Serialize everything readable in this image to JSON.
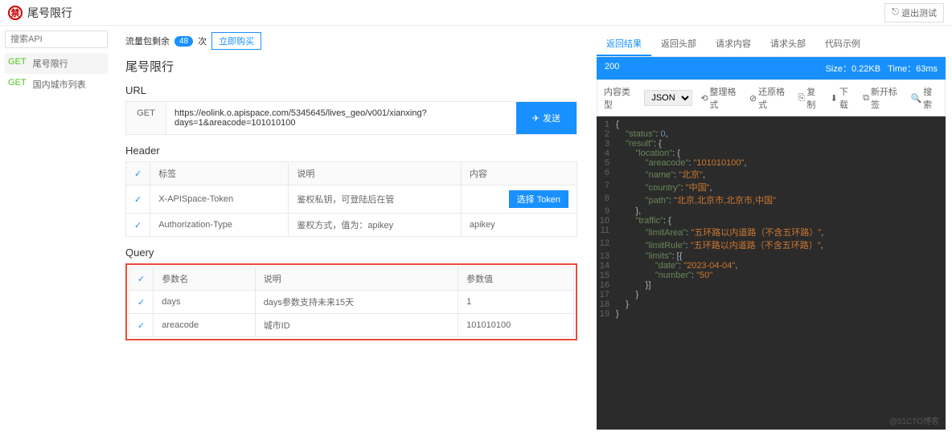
{
  "header": {
    "title": "尾号限行",
    "exit": "退出测试"
  },
  "sidebar": {
    "search_placeholder": "搜索API",
    "items": [
      {
        "method": "GET",
        "name": "尾号限行",
        "active": true
      },
      {
        "method": "GET",
        "name": "国内城市列表",
        "active": false
      }
    ]
  },
  "flow": {
    "label": "流量包剩余",
    "count": "48",
    "unit": "次",
    "buy": "立即购买"
  },
  "page_title": "尾号限行",
  "url": {
    "label": "URL",
    "method": "GET",
    "value": "https://eolink.o.apispace.com/5345645/lives_geo/v001/xianxing?days=1&areacode=101010100",
    "send": "发送"
  },
  "header_section": {
    "label": "Header",
    "cols": [
      "标签",
      "说明",
      "内容"
    ],
    "select_token": "选择 Token",
    "rows": [
      {
        "tag": "X-APISpace-Token",
        "desc": "鉴权私钥，可登陆后在管",
        "content": ""
      },
      {
        "tag": "Authorization-Type",
        "desc": "鉴权方式，值为：apikey",
        "content": "apikey"
      }
    ]
  },
  "query": {
    "label": "Query",
    "cols": [
      "参数名",
      "说明",
      "参数值"
    ],
    "rows": [
      {
        "name": "days",
        "desc": "days参数支持未来15天",
        "value": "1"
      },
      {
        "name": "areacode",
        "desc": "城市ID",
        "value": "101010100"
      }
    ]
  },
  "response": {
    "tabs": [
      "返回结果",
      "返回头部",
      "请求内容",
      "请求头部",
      "代码示例"
    ],
    "active_tab": 0,
    "status": "200",
    "size": "Size：0.22KB",
    "time": "Time：63ms",
    "toolbar": {
      "content_type": "内容类型",
      "format": "JSON",
      "tidy": "整理格式",
      "restore": "还原格式",
      "copy": "复制",
      "download": "下载",
      "newtab": "新开标签",
      "search": "搜索"
    },
    "json": {
      "status": 0,
      "result": {
        "location": {
          "areacode": "101010100",
          "name": "北京",
          "country": "中国",
          "path": "北京,北京市,北京市,中国"
        },
        "traffic": {
          "limitArea": "五环路以内道路（不含五环路）",
          "limitRule": "五环路以内道路（不含五环路）",
          "limits": [
            {
              "date": "2023-04-04",
              "number": "50"
            }
          ]
        }
      }
    },
    "code_lines": [
      "{",
      "    \"status\": 0,",
      "    \"result\": {",
      "        \"location\": {",
      "            \"areacode\": \"101010100\",",
      "            \"name\": \"北京\",",
      "            \"country\": \"中国\",",
      "            \"path\": \"北京,北京市,北京市,中国\"",
      "        },",
      "        \"traffic\": {",
      "            \"limitArea\": \"五环路以内道路（不含五环路）\",",
      "            \"limitRule\": \"五环路以内道路（不含五环路）\",",
      "            \"limits\": [{",
      "                \"date\": \"2023-04-04\",",
      "                \"number\": \"50\"",
      "            }]",
      "        }",
      "    }",
      "}"
    ]
  },
  "watermark": "@51CTO博客"
}
